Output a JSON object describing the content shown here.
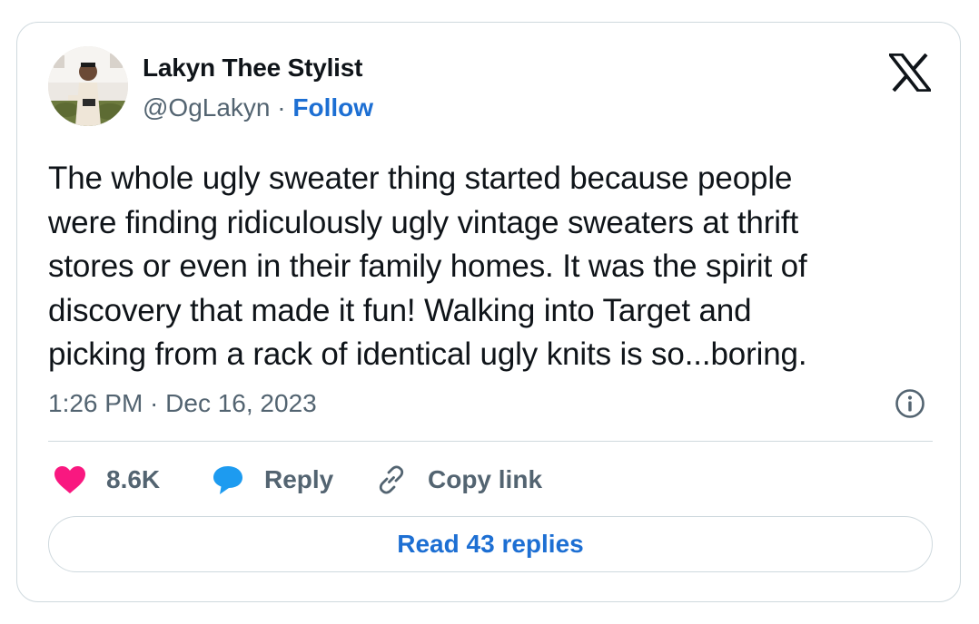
{
  "author": {
    "name": "Lakyn Thee Stylist",
    "handle": "@OgLakyn",
    "separator": "·",
    "follow_label": "Follow"
  },
  "tweet": {
    "lines": [
      "The whole ugly sweater thing started because people",
      "were finding ridiculously ugly vintage sweaters at thrift",
      "stores or even in their family homes. It was the spirit of",
      "discovery that made it fun! Walking into Target and",
      "picking from a rack of identical ugly knits is so...boring."
    ],
    "timestamp": "1:26 PM · Dec 16, 2023"
  },
  "actions": {
    "likes_count": "8.6K",
    "reply_label": "Reply",
    "copy_link_label": "Copy link"
  },
  "footer": {
    "read_replies_label": "Read 43 replies"
  },
  "icons": {
    "logo": "x-logo-icon",
    "info": "info-icon",
    "like": "heart-icon",
    "reply": "speech-bubble-icon",
    "copy_link": "link-icon"
  },
  "colors": {
    "text": "#0f1419",
    "secondary": "#536471",
    "link": "#1d6fd3",
    "heart": "#f91880",
    "reply_bubble": "#1d9bf0",
    "border": "#cfd9de"
  }
}
